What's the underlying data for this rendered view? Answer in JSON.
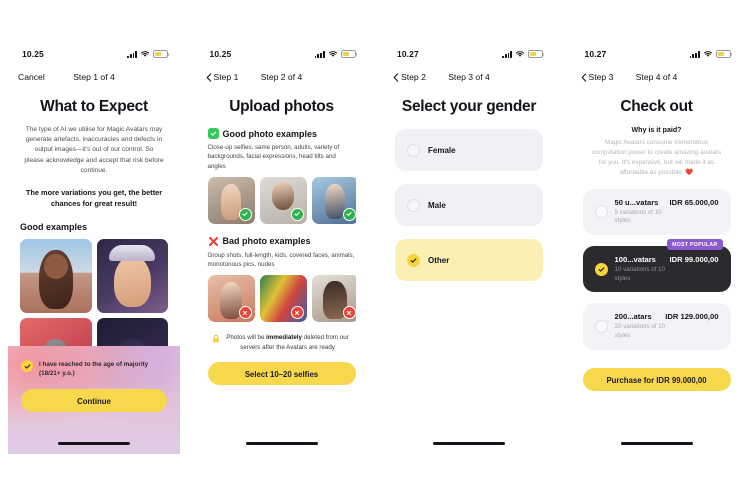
{
  "panels": [
    {
      "status": {
        "time": "10.25"
      },
      "nav": {
        "back_label": "Cancel",
        "title": "Step 1 of 4",
        "has_chevron": false
      },
      "title": "What to Expect",
      "paragraph": "The type of AI we utilise for Magic Avatars may generate artefacts, inaccuracies and defects in output images—it's out of our control. So please acknowledge and accept that risk before continue.",
      "bold_note": "The more variations you get, the better chances for great result!",
      "section_heading": "Good examples",
      "consent_text": "I have reached to the age of majority (18/21+ y.o.)",
      "consent_checked": true,
      "button_label": "Continue"
    },
    {
      "status": {
        "time": "10.25"
      },
      "nav": {
        "back_label": "Step 1",
        "title": "Step 2 of 4",
        "has_chevron": true
      },
      "title": "Upload photos",
      "good_heading": "Good photo examples",
      "good_desc": "Close-up selfies, same person, adults, variety of backgrounds, facial expressions, head tilts and angles",
      "bad_heading": "Bad photo examples",
      "bad_desc": "Group shots, full-length, kids, covered faces, animals, monotonous pics, nudes",
      "privacy_pre": "Photos will be ",
      "privacy_bold": "immediately",
      "privacy_post": " deleted from our servers after the Avatars are ready",
      "button_label": "Select 10–20 selfies"
    },
    {
      "status": {
        "time": "10.27"
      },
      "nav": {
        "back_label": "Step 2",
        "title": "Step 3 of 4",
        "has_chevron": true
      },
      "title": "Select your gender",
      "options": [
        {
          "label": "Female",
          "selected": false
        },
        {
          "label": "Male",
          "selected": false
        },
        {
          "label": "Other",
          "selected": true
        }
      ]
    },
    {
      "status": {
        "time": "10.27"
      },
      "nav": {
        "back_label": "Step 3",
        "title": "Step 4 of 4",
        "has_chevron": true
      },
      "title": "Check out",
      "why_heading": "Why is it paid?",
      "why_text": "Magic Avatars consume tremendous computation power to create amazing avatars for you. It's expensive, but we made it as affordable as possible. ❤️",
      "badge_label": "MOST POPULAR",
      "plans": [
        {
          "name": "50 u...vatars",
          "price": "IDR 65.000,00",
          "sub": "5 variations of 10 styles",
          "selected": false,
          "popular": false
        },
        {
          "name": "100...vatars",
          "price": "IDR 99.000,00",
          "sub": "10 variations of 10 styles",
          "selected": true,
          "popular": true
        },
        {
          "name": "200...atars",
          "price": "IDR 129.000,00",
          "sub": "20 variations of 10 styles",
          "selected": false,
          "popular": false
        }
      ],
      "button_label": "Purchase for IDR 99.000,00"
    }
  ],
  "colors": {
    "accent_yellow": "#f7d74b",
    "badge_purple": "#8e58cf",
    "good_green": "#34c759",
    "bad_red": "#e8443a"
  }
}
